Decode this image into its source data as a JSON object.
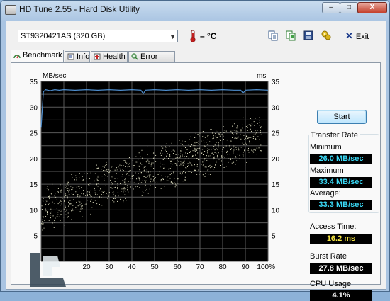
{
  "window": {
    "title": "HD Tune 2.55 - Hard Disk Utility",
    "controls": {
      "minimize": "–",
      "maximize": "□",
      "close": "X"
    }
  },
  "toolbar": {
    "drive": "ST9320421AS (320 GB)",
    "temperature": "– °C",
    "exit_label": "Exit",
    "icons": [
      "copy-info-icon",
      "copy-screenshot-icon",
      "save-icon",
      "options-icon"
    ]
  },
  "tabs": [
    {
      "label": "Benchmark",
      "icon": "benchmark-icon",
      "active": true
    },
    {
      "label": "Info",
      "icon": "info-icon",
      "active": false
    },
    {
      "label": "Health",
      "icon": "health-icon",
      "active": false
    },
    {
      "label": "Error Scan",
      "icon": "error-scan-icon",
      "active": false
    }
  ],
  "actions": {
    "start": "Start"
  },
  "results": {
    "transfer_rate_title": "Transfer Rate",
    "minimum_label": "Minimum",
    "minimum_value": "26.0 MB/sec",
    "maximum_label": "Maximum",
    "maximum_value": "33.4 MB/sec",
    "average_label": "Average:",
    "average_value": "33.3 MB/sec",
    "access_time_label": "Access Time:",
    "access_time_value": "16.2 ms",
    "burst_rate_label": "Burst Rate",
    "burst_rate_value": "27.8 MB/sec",
    "cpu_usage_label": "CPU Usage",
    "cpu_usage_value": "4.1%"
  },
  "colors": {
    "plot_bg": "#000000",
    "grid": "#5a5a5a",
    "transfer_line": "#4f8fcf",
    "access_dots": "#e8e8c8",
    "value_cyan": "#3ad8f5",
    "value_yellow": "#f4e442"
  },
  "chart_data": {
    "type": "line",
    "left_unit": "MB/sec",
    "right_unit": "ms",
    "y_left_ticks": [
      "35",
      "30",
      "25",
      "20",
      "15",
      "10",
      "5"
    ],
    "y_right_ticks": [
      "35",
      "30",
      "25",
      "20",
      "15",
      "10",
      "5"
    ],
    "x_ticks": [
      "20",
      "30",
      "40",
      "50",
      "60",
      "70",
      "80",
      "90",
      "100%"
    ],
    "ylim": [
      0,
      35
    ],
    "xlim": [
      0,
      100
    ],
    "grid": true,
    "series": [
      {
        "kind": "transfer-rate-line",
        "x": [
          0,
          1,
          2,
          4,
          6,
          8,
          10,
          15,
          20,
          25,
          30,
          35,
          40,
          44,
          45,
          46,
          50,
          55,
          60,
          65,
          70,
          75,
          80,
          85,
          88,
          89,
          90,
          95,
          100
        ],
        "y": [
          26.0,
          33.0,
          33.4,
          33.2,
          33.4,
          33.3,
          33.4,
          33.3,
          33.4,
          33.3,
          33.4,
          33.3,
          33.4,
          33.3,
          32.6,
          33.3,
          33.4,
          33.3,
          33.4,
          33.3,
          33.4,
          33.3,
          33.4,
          33.3,
          33.3,
          32.7,
          33.3,
          33.4,
          33.3
        ]
      },
      {
        "kind": "access-time-scatter",
        "trend_ms": [
          [
            0,
            10
          ],
          [
            25,
            14.5
          ],
          [
            50,
            18
          ],
          [
            75,
            21.5
          ],
          [
            100,
            25
          ]
        ],
        "spread_ms": 5,
        "count": 1100
      }
    ]
  }
}
